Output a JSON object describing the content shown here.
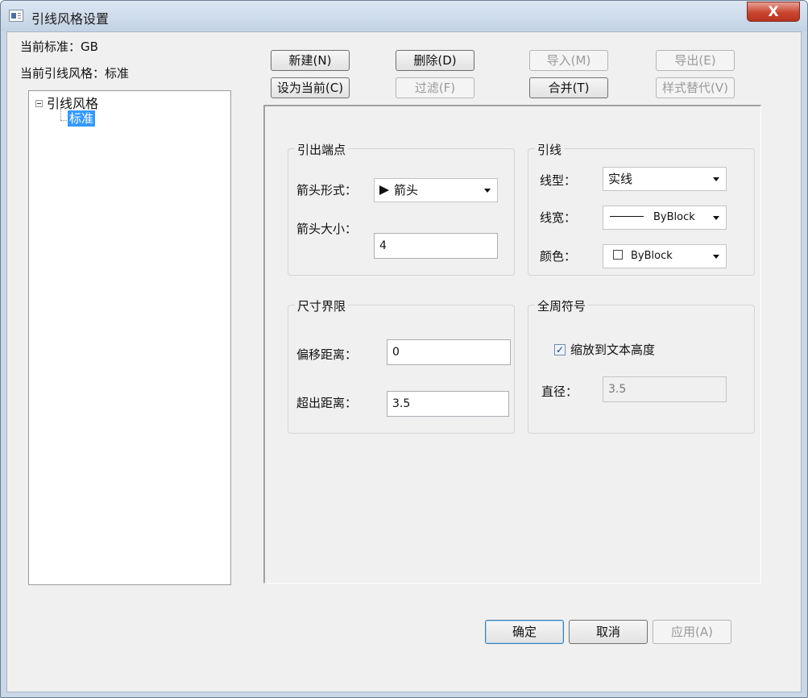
{
  "window": {
    "title": "引线风格设置",
    "close_glyph": "X"
  },
  "info": {
    "current_standard": "当前标准：GB",
    "current_leader_style": "当前引线风格：标准"
  },
  "tree": {
    "root_label": "引线风格",
    "child_label": "标准"
  },
  "toolbar": {
    "new_label": "新建(N)",
    "delete_label": "删除(D)",
    "import_label": "导入(M)",
    "export_label": "导出(E)",
    "set_current_label": "设为当前(C)",
    "filter_label": "过滤(F)",
    "merge_label": "合并(T)",
    "override_label": "样式替代(V)"
  },
  "leader_end": {
    "title": "引出端点",
    "arrow_type_label": "箭头形式：",
    "arrow_type_value": "箭头",
    "arrow_size_label": "箭头大小：",
    "arrow_size_value": "4"
  },
  "leader_line": {
    "title": "引线",
    "linetype_label": "线型：",
    "linetype_value": "实线",
    "lineweight_label": "线宽：",
    "lineweight_value": "ByBlock",
    "color_label": "颜色：",
    "color_value": "ByBlock"
  },
  "ext_line": {
    "title": "尺寸界限",
    "offset_label": "偏移距离：",
    "offset_value": "0",
    "extend_label": "超出距离：",
    "extend_value": "3.5"
  },
  "all_around": {
    "title": "全周符号",
    "scale_checkbox_label": "缩放到文本高度",
    "scale_checked": true,
    "check_glyph": "✓",
    "diameter_label": "直径：",
    "diameter_value": "3.5"
  },
  "footer": {
    "ok_label": "确定",
    "cancel_label": "取消",
    "apply_label": "应用(A)"
  },
  "colors": {
    "selection": "#3399ff",
    "dialog_bg": "#f0f0f0",
    "close_button": "#c9452f"
  }
}
